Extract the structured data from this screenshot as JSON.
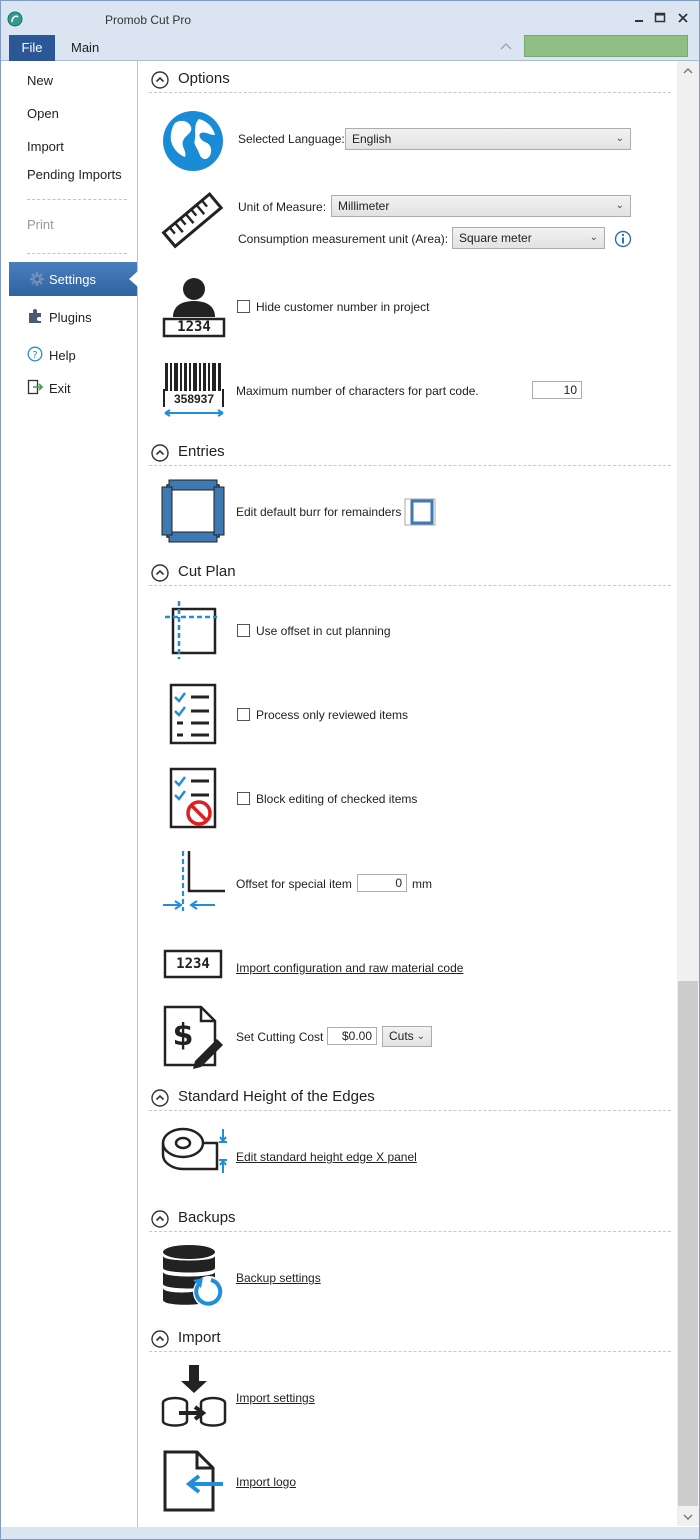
{
  "window": {
    "title": "Promob Cut Pro"
  },
  "ribbon": {
    "tab_file": "File",
    "tab_main": "Main"
  },
  "sidebar": {
    "new": "New",
    "open": "Open",
    "import": "Import",
    "pending_imports": "Pending Imports",
    "print": "Print",
    "settings": "Settings",
    "plugins": "Plugins",
    "help": "Help",
    "exit": "Exit"
  },
  "sections": {
    "options": "Options",
    "entries": "Entries",
    "cut_plan": "Cut Plan",
    "edges": "Standard Height of the Edges",
    "backups": "Backups",
    "import": "Import"
  },
  "options": {
    "language_label": "Selected Language:",
    "language_value": "English",
    "unit_label": "Unit of Measure:",
    "unit_value": "Millimeter",
    "area_label": "Consumption measurement unit (Area):",
    "area_value": "Square meter",
    "hide_customer_label": "Hide customer number in project",
    "customer_number": "1234",
    "barcode_number": "358937",
    "max_chars_label": "Maximum number of characters for part code.",
    "max_chars_value": "10"
  },
  "entries": {
    "burr_label": "Edit default burr for remainders"
  },
  "cut_plan": {
    "offset_label": "Use offset in cut planning",
    "reviewed_label": "Process only reviewed items",
    "block_label": "Block editing of checked items",
    "special_offset_label": "Offset for special item",
    "special_offset_value": "0",
    "special_offset_unit": "mm",
    "import_icon_number": "1234",
    "import_config_link": "Import configuration and raw material code",
    "cost_label": "Set Cutting Cost",
    "cost_value": "$0.00",
    "cost_unit": "Cuts"
  },
  "edges": {
    "edit_link": "Edit standard height edge X panel"
  },
  "backups": {
    "settings_link": "Backup settings"
  },
  "import": {
    "settings_link": "Import settings",
    "logo_link": "Import logo"
  },
  "colors": {
    "accent": "#2b5797",
    "icon_blue": "#1e8fd8",
    "status_green": "#8fbf85",
    "globe": "#1a8bd6"
  }
}
